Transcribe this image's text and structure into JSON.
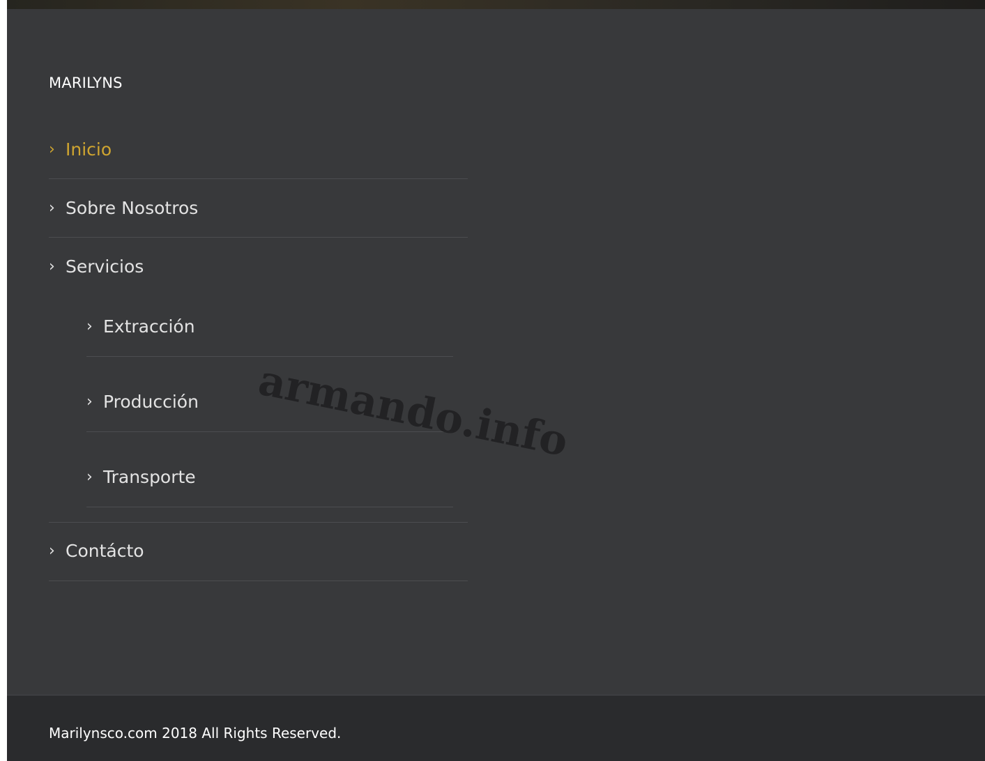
{
  "site": {
    "widget_title": "MARILYNS"
  },
  "menu": {
    "items": [
      {
        "label": "Inicio",
        "active": true,
        "level": 0
      },
      {
        "label": "Sobre Nosotros",
        "active": false,
        "level": 0
      },
      {
        "label": "Servicios",
        "active": false,
        "level": 0
      },
      {
        "label": "Extracción",
        "active": false,
        "level": 1
      },
      {
        "label": "Producción",
        "active": false,
        "level": 1
      },
      {
        "label": "Transporte",
        "active": false,
        "level": 1
      },
      {
        "label": "Contácto",
        "active": false,
        "level": 0
      }
    ],
    "chevron": "›"
  },
  "watermark": {
    "text": "armando.info"
  },
  "footer": {
    "copyright": "Marilynsco.com 2018 All Rights Reserved."
  },
  "colors": {
    "panel_background": "#38393b",
    "footer_background": "#2a2b2d",
    "accent": "#cfa530",
    "link_text": "#e3e3e3",
    "divider": "#4c4d50"
  }
}
